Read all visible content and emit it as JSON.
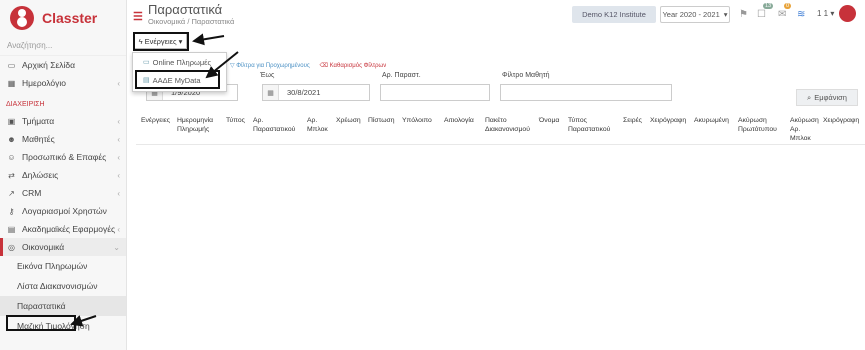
{
  "app": {
    "name": "Classter"
  },
  "sidebar": {
    "search_placeholder": "Αναζήτηση...",
    "items": [
      {
        "label": "Αρχική Σελίδα",
        "icon": "laptop-icon"
      },
      {
        "label": "Ημερολόγιο",
        "icon": "calendar-icon"
      }
    ],
    "section": "ΔΙΑΧΕΙΡΙΣΗ",
    "admin_items": [
      {
        "label": "Τμήματα",
        "icon": "briefcase-icon"
      },
      {
        "label": "Μαθητές",
        "icon": "users-icon"
      },
      {
        "label": "Προσωπικό & Επαφές",
        "icon": "people-icon"
      },
      {
        "label": "Δηλώσεις",
        "icon": "share-icon"
      },
      {
        "label": "CRM",
        "icon": "chart-icon"
      },
      {
        "label": "Λογαριασμοί Χρηστών",
        "icon": "key-icon"
      },
      {
        "label": "Ακαδημαϊκές Εφαρμογές",
        "icon": "apps-icon"
      },
      {
        "label": "Οικονομικά",
        "icon": "coins-icon"
      }
    ],
    "sub_items": [
      "Εικόνα Πληρωμών",
      "Λίστα Διακανονισμών",
      "Παραστατικά",
      "Μαζική Τιμολόγηση"
    ]
  },
  "header": {
    "title": "Παραστατικά",
    "breadcrumb": [
      "Οικονομικά",
      "Παραστατικά"
    ],
    "institute": "Demo K12 Institute",
    "year": "Year 2020 - 2021",
    "badge_tasks": "13",
    "badge_mail": "0",
    "user": "1 1"
  },
  "actions": {
    "label": "Ενέργειες",
    "menu": [
      "Online Πληρωμές",
      "ΑΑΔΕ MyData"
    ]
  },
  "filters": {
    "advanced_link": "Φίλτρα για Προχωρημένους",
    "clear_link": "Καθαρισμός Φίλτρων",
    "from_value": "1/9/2020",
    "to_label": "Έως",
    "to_value": "30/8/2021",
    "doc_no_label": "Αρ. Παραστ.",
    "student_label": "Φίλτρο Μαθητή",
    "search_button": "Εμφάνιση"
  },
  "table": {
    "columns": [
      "Ενέργειες",
      "Ημερομηνία Πληρωμής",
      "Τύπος",
      "Αρ. Παραστατικού",
      "Αρ. Μπλοκ",
      "Χρέωση",
      "Πίστωση",
      "Υπόλοιπο",
      "Αιτιολογία",
      "Πακέτο Διακανονισμού",
      "Όνομα",
      "Τύπος Παραστατικού",
      "Σειρές",
      "Χειρόγραφη",
      "Ακυρωμένη",
      "Ακύρωση Πρωτότυπου",
      "Ακύρωση Αρ. Μπλοκ",
      "Χειρόγραφη"
    ]
  },
  "colors": {
    "brand": "#c7323a",
    "link": "#4a90c4"
  }
}
